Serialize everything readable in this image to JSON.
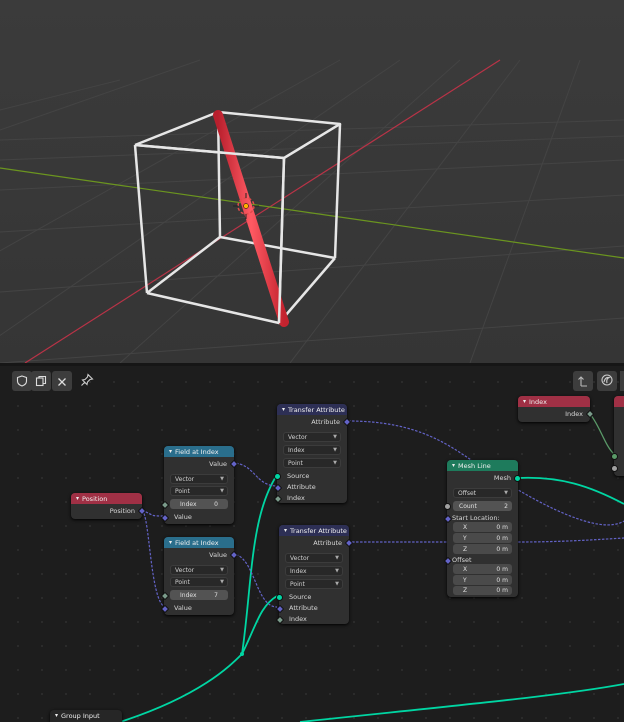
{
  "toolbar": {
    "shield_icon": "shield-icon",
    "copy_icon": "copy-icon",
    "close_icon": "close-icon",
    "pin_icon": "pin-icon",
    "arrow_icon": "arrow-icon",
    "overlay_icon": "overlay-icon"
  },
  "nodes": {
    "position": {
      "title": "Position",
      "out": "Position"
    },
    "field_at_index_1": {
      "title": "Field at Index",
      "out": "Value",
      "type": "Vector",
      "domain": "Point",
      "index_label": "Index",
      "index_value": "0",
      "in_value": "Value"
    },
    "field_at_index_2": {
      "title": "Field at Index",
      "out": "Value",
      "type": "Vector",
      "domain": "Point",
      "index_label": "Index",
      "index_value": "7",
      "in_value": "Value"
    },
    "transfer_1": {
      "title": "Transfer Attribute",
      "out": "Attribute",
      "type": "Vector",
      "mode": "Index",
      "domain": "Point",
      "in_source": "Source",
      "in_attribute": "Attribute",
      "in_index": "Index"
    },
    "transfer_2": {
      "title": "Transfer Attribute",
      "out": "Attribute",
      "type": "Vector",
      "mode": "Index",
      "domain": "Point",
      "in_source": "Source",
      "in_attribute": "Attribute",
      "in_index": "Index"
    },
    "mesh_line": {
      "title": "Mesh Line",
      "out": "Mesh",
      "mode": "Offset",
      "count_label": "Count",
      "count_value": "2",
      "start_label": "Start Location:",
      "x": "X",
      "y": "Y",
      "z": "Z",
      "zero": "0 m",
      "offset_label": "Offset"
    },
    "index": {
      "title": "Index",
      "out": "Index"
    },
    "group_input": {
      "title": "Group Input"
    }
  },
  "colors": {
    "geometry_link": "#00d6a3",
    "vector_link": "#6363c7",
    "axis_x": "#c9384a",
    "axis_y": "#6f9a1c",
    "rod": "#e8323f"
  }
}
